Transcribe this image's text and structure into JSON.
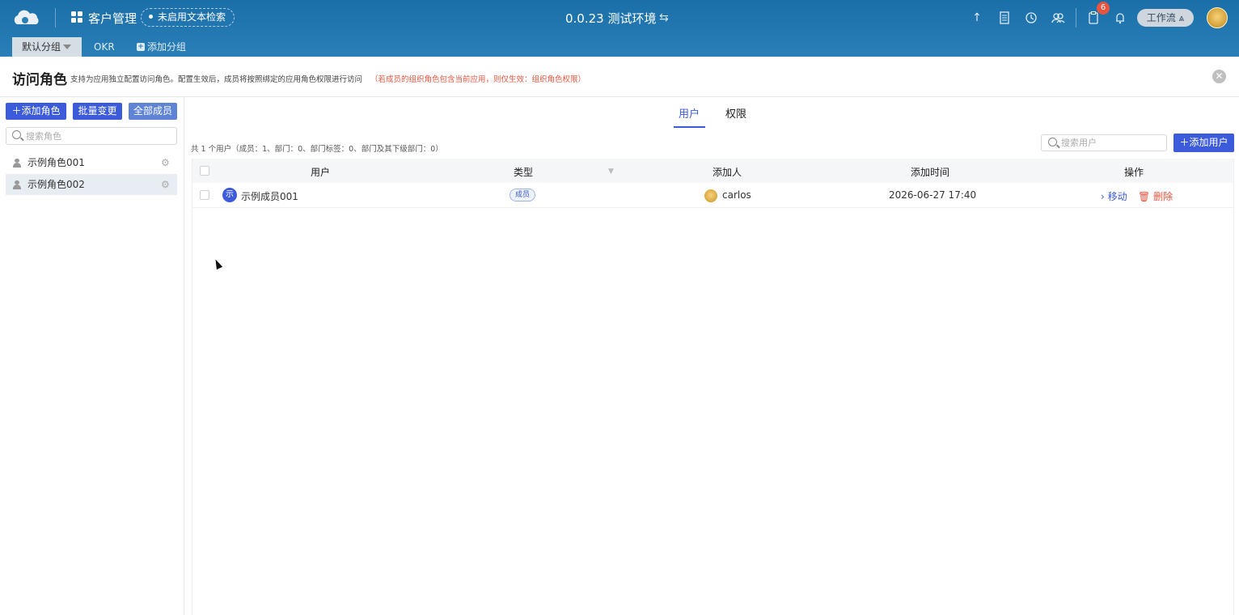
{
  "topbar": {
    "app_title": "客户管理",
    "search_badge": "未启用文本检索",
    "env_title": "0.0.23 测试环境",
    "notification_count": "6",
    "workflow_label": "工作流",
    "colors": {
      "bar": "#1b6fa8",
      "badge": "#e8553f"
    },
    "icons": [
      "cloud-logo-icon",
      "grid-icon",
      "swap-icon",
      "pin-icon",
      "document-icon",
      "clock-icon",
      "users-icon",
      "clipboard-icon",
      "bell-icon",
      "sitemap-icon"
    ]
  },
  "tabs": {
    "default_group": "默认分组",
    "okr": "OKR",
    "add_group": "添加分组"
  },
  "panel": {
    "title": "访问角色",
    "description": "支持为应用独立配置访问角色。配置生效后，成员将按照绑定的应用角色权限进行访问",
    "warning": "（若成员的组织角色包含当前应用，则仅生效：组织角色权限）"
  },
  "sidebar": {
    "add_role": "添加角色",
    "batch_change": "批量变更",
    "all_members": "全部成员",
    "search_placeholder": "搜索角色",
    "roles": [
      {
        "name": "示例角色001"
      },
      {
        "name": "示例角色002"
      }
    ]
  },
  "main": {
    "tabs": [
      "用户",
      "权限"
    ],
    "summary": "共 1 个用户（成员：1、部门：0、部门标签：0、部门及其下级部门：0）",
    "search_placeholder": "搜索用户",
    "add_user": "添加用户",
    "columns": [
      "用户",
      "类型",
      "添加人",
      "添加时间",
      "操作"
    ],
    "rows": [
      {
        "avatar_char": "示",
        "user": "示例成员001",
        "type": "成员",
        "adder": "carlos",
        "time": "2026-06-27 17:40",
        "move": "移动",
        "delete": "删除"
      }
    ]
  }
}
